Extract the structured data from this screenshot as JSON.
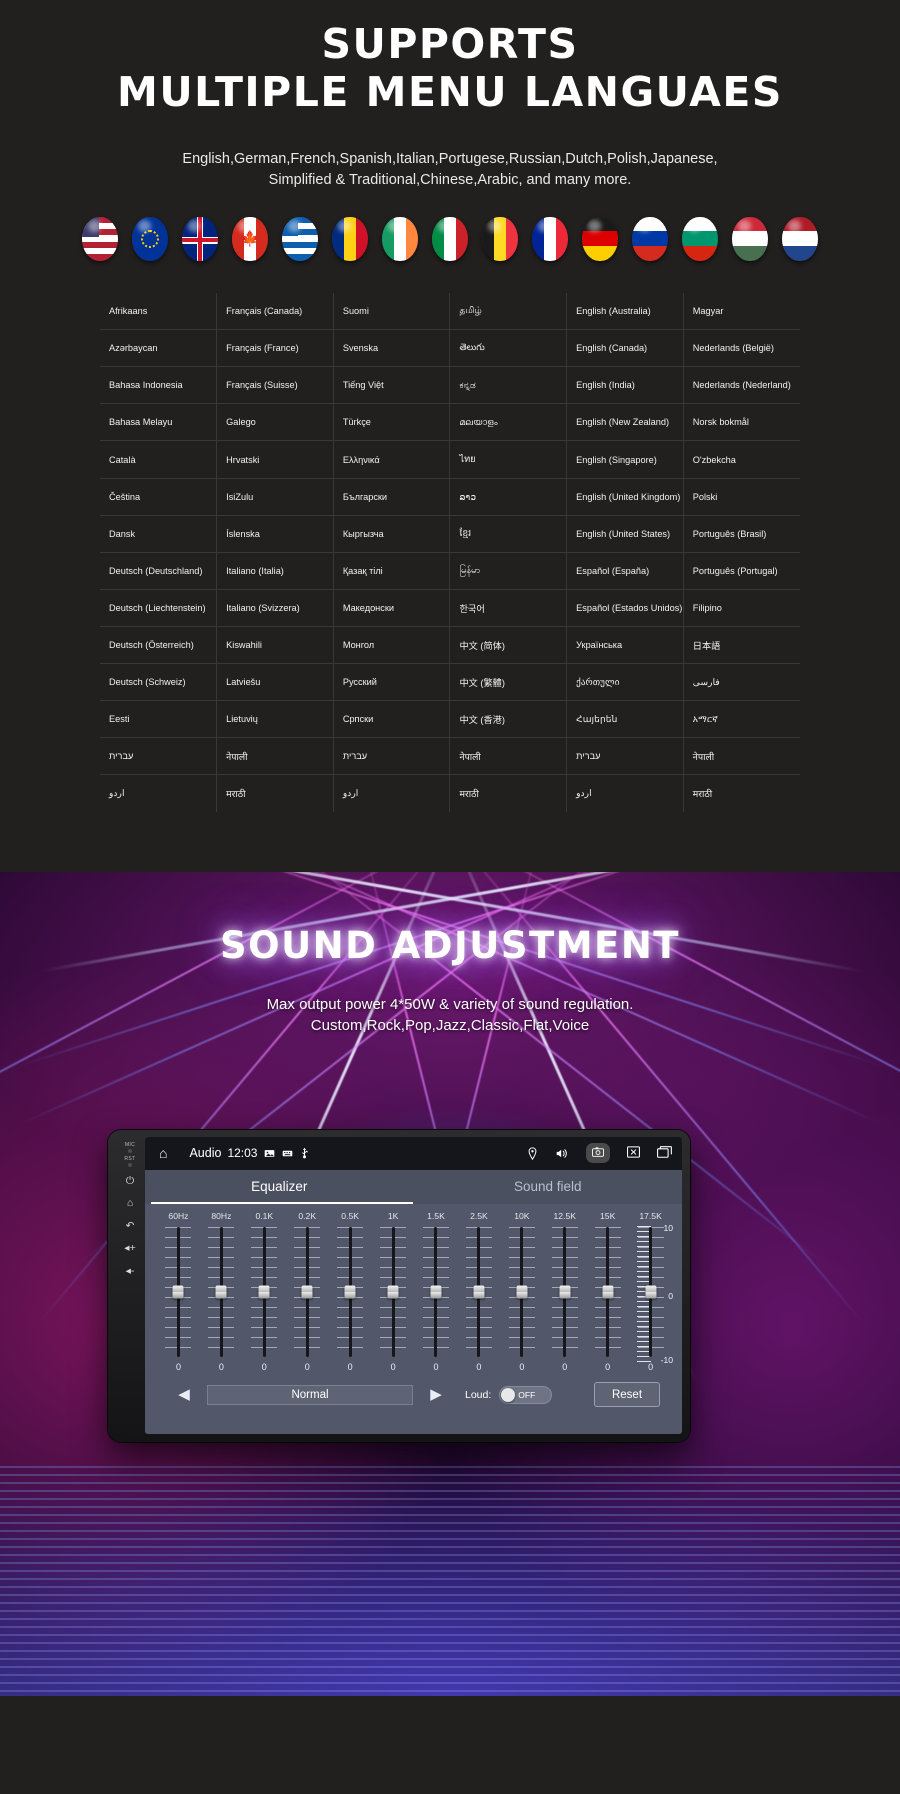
{
  "languages_section": {
    "headline_line1": "SUPPORTS",
    "headline_line2": "MULTIPLE MENU LANGUAES",
    "subhead_line1": "English,German,French,Spanish,Italian,Portugese,Russian,Dutch,Polish,Japanese,",
    "subhead_line2": "Simplified & Traditional,Chinese,Arabic, and many more.",
    "flags": [
      {
        "name": "flag-usa",
        "type": "usa"
      },
      {
        "name": "flag-european-union",
        "type": "eu"
      },
      {
        "name": "flag-united-kingdom",
        "type": "uk"
      },
      {
        "name": "flag-canada",
        "type": "canada"
      },
      {
        "name": "flag-greece",
        "type": "greece"
      },
      {
        "name": "flag-romania",
        "type": "romania"
      },
      {
        "name": "flag-ireland",
        "type": "ireland"
      },
      {
        "name": "flag-italy",
        "type": "italy"
      },
      {
        "name": "flag-belgium",
        "type": "belgium"
      },
      {
        "name": "flag-france",
        "type": "france"
      },
      {
        "name": "flag-germany",
        "type": "germany"
      },
      {
        "name": "flag-russia",
        "type": "russia"
      },
      {
        "name": "flag-bulgaria",
        "type": "bulgaria"
      },
      {
        "name": "flag-hungary",
        "type": "hungary"
      },
      {
        "name": "flag-netherlands",
        "type": "netherlands"
      }
    ],
    "table_rows": [
      [
        "Afrikaans",
        "Français (Canada)",
        "Suomi",
        "தமிழ்",
        "English (Australia)",
        "Magyar"
      ],
      [
        "Azərbaycan",
        "Français (France)",
        "Svenska",
        "తెలుగు",
        "English (Canada)",
        "Nederlands (België)"
      ],
      [
        "Bahasa Indonesia",
        "Français (Suisse)",
        "Tiếng Việt",
        "ಕನ್ನಡ",
        "English (India)",
        "Nederlands (Nederland)"
      ],
      [
        "Bahasa Melayu",
        "Galego",
        "Türkçe",
        "മലയാളം",
        "English (New Zealand)",
        "Norsk bokmål"
      ],
      [
        "Català",
        "Hrvatski",
        "Ελληνικά",
        "ไทย",
        "English (Singapore)",
        "O'zbekcha"
      ],
      [
        "Čeština",
        "IsiZulu",
        "Български",
        "ລາວ",
        "English (United Kingdom)",
        "Polski"
      ],
      [
        "Dansk",
        "Íslenska",
        "Кыргызча",
        "ខ្មែរ",
        "English (United States)",
        "Português (Brasil)"
      ],
      [
        "Deutsch (Deutschland)",
        "Italiano (Italia)",
        "Қазақ тілі",
        "မြန်မာ",
        "Español (España)",
        "Português (Portugal)"
      ],
      [
        "Deutsch (Liechtenstein)",
        "Italiano (Svizzera)",
        "Македонски",
        "한국어",
        "Español (Estados Unidos)",
        "Filipino"
      ],
      [
        "Deutsch (Österreich)",
        "Kiswahili",
        "Монгол",
        "中文 (简体)",
        "Українська",
        "日本語"
      ],
      [
        "Deutsch (Schweiz)",
        "Latviešu",
        "Русский",
        "中文 (繁體)",
        "ქართული",
        "فارسی"
      ],
      [
        "Eesti",
        "Lietuvių",
        "Српски",
        "中文 (香港)",
        "Հայերեն",
        "አማርኛ"
      ],
      [
        "עברית",
        "नेपाली",
        "עברית",
        "नेपाली",
        "עברית",
        "नेपाली"
      ],
      [
        "اردو",
        "मराठी",
        "اردو",
        "मराठी",
        "اردو",
        "मराठी"
      ]
    ]
  },
  "sound_section": {
    "title": "SOUND ADJUSTMENT",
    "sub_line1": "Max output power 4*50W & variety of sound regulation.",
    "sub_line2": "Custom,Rock,Pop,Jazz,Classic,Flat,Voice",
    "head_unit": {
      "rail": {
        "mic_label": "MIC",
        "rst_label": "RST",
        "power_icon": "⏻",
        "home_icon": "⌂",
        "back_icon": "↶",
        "vol_up_icon": "◂+",
        "vol_down_icon": "◂-"
      },
      "statusbar": {
        "home_icon": "⌂",
        "title": "Audio",
        "clock": "12:03",
        "mini_icons": [
          "picture-icon",
          "keyboard-icon",
          "usb-icon"
        ],
        "right_icons": [
          "location-icon",
          "volume-icon",
          "screenshot-icon",
          "close-icon",
          "recents-icon"
        ]
      },
      "tabs": [
        {
          "label": "Equalizer",
          "active": true
        },
        {
          "label": "Sound field",
          "active": false
        }
      ],
      "equalizer": {
        "frequencies": [
          "60Hz",
          "80Hz",
          "0.1K",
          "0.2K",
          "0.5K",
          "1K",
          "1.5K",
          "2.5K",
          "10K",
          "12.5K",
          "15K",
          "17.5K"
        ],
        "values": [
          0,
          0,
          0,
          0,
          0,
          0,
          0,
          0,
          0,
          0,
          0,
          0
        ],
        "meter_top": "10",
        "meter_mid": "0",
        "meter_bottom": "-10",
        "prev_icon": "◀",
        "next_icon": "▶",
        "preset_name": "Normal",
        "loud_label": "Loud:",
        "loud_state": "OFF",
        "reset_label": "Reset"
      }
    }
  }
}
